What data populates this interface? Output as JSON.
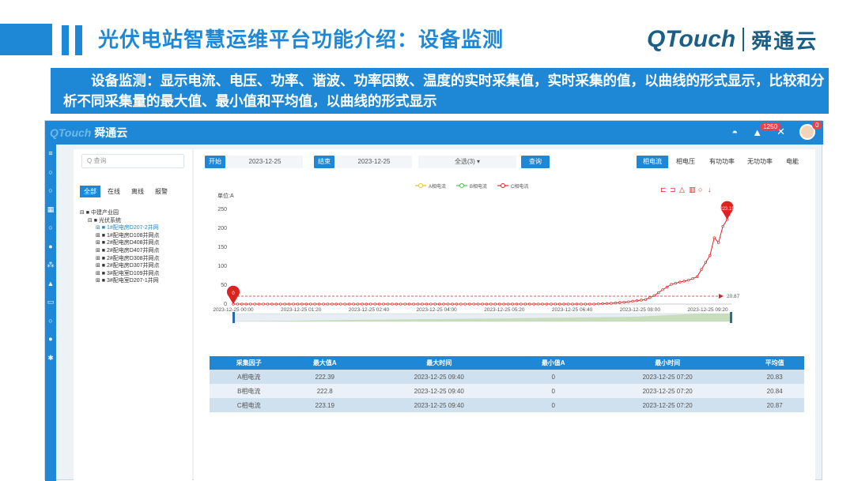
{
  "slide": {
    "title": "光伏电站智慧运维平台功能介绍：设备监测",
    "logo_brand": "QTouch",
    "logo_cn": "舜通云",
    "banner": "设备监测：显示电流、电压、功率、谐波、功率因数、温度的实时采集值，实时采集的值，以曲线的形式显示，比较和分析不同采集量的最大值、最小值和平均值，以曲线的形式显示"
  },
  "app": {
    "logo_brand": "QTouch",
    "logo_cn": "舜通云",
    "bell_badge": "1250",
    "avatar_badge": "0",
    "search_placeholder": "查询",
    "tabs": [
      "全部",
      "在线",
      "离线",
      "报警"
    ],
    "tree": {
      "root": "中建产业园",
      "system": "光伏系统",
      "items": [
        "1#配电房D207-2并网",
        "1#配电房D108并网点",
        "2#配电房D408并网点",
        "2#配电房D407并网点",
        "2#配电房D308并网点",
        "2#配电房D307并网点",
        "3#配电室D109并网点",
        "3#配电室D207-1并网"
      ]
    },
    "toolbar": {
      "start_label": "开始",
      "start_date": "2023-12-25",
      "end_label": "结束",
      "end_date": "2023-12-25",
      "select_all": "全选(3) ▾",
      "query": "查询",
      "phases": [
        "相电流",
        "相电压",
        "有功功率",
        "无功功率",
        "电能"
      ]
    }
  },
  "chart_data": {
    "type": "line",
    "ylabel": "单位:A",
    "ylim": [
      0,
      250
    ],
    "yticks": [
      0,
      50,
      100,
      150,
      200,
      250
    ],
    "xticks": [
      "2023-12-25 00:00",
      "2023-12-25 01:20",
      "2023-12-25 02:40",
      "2023-12-25 04:00",
      "2023-12-25 05:20",
      "2023-12-25 06:40",
      "2023-12-25 08:00",
      "2023-12-25 09:20"
    ],
    "legend": [
      "A相电流",
      "B相电流",
      "C相电流"
    ],
    "series": [
      {
        "name": "C相电流",
        "color": "#dd2222",
        "x_minutes": [
          0,
          60,
          120,
          180,
          240,
          300,
          360,
          420,
          440,
          460,
          480,
          490,
          500,
          510,
          520,
          530,
          540,
          550,
          555,
          560,
          565,
          570,
          575
        ],
        "values": [
          0,
          0,
          0,
          0,
          0,
          0,
          0,
          0,
          2,
          6,
          12,
          22,
          38,
          52,
          58,
          63,
          72,
          110,
          128,
          175,
          162,
          205,
          223.19
        ]
      }
    ],
    "max_marker": "223.19",
    "min_marker": "0",
    "avg_marker": "20.87",
    "toolbox_icons": [
      "area-zoom-icon",
      "zoom-reset-icon",
      "line-icon",
      "bar-icon",
      "restore-icon",
      "download-icon"
    ]
  },
  "table": {
    "headers": [
      "采集因子",
      "最大值A",
      "最大时间",
      "最小值A",
      "最小时间",
      "平均值"
    ],
    "rows": [
      [
        "A相电流",
        "222.39",
        "2023-12-25 09:40",
        "0",
        "2023-12-25 07:20",
        "20.83"
      ],
      [
        "B相电流",
        "222.8",
        "2023-12-25 09:40",
        "0",
        "2023-12-25 07:20",
        "20.84"
      ],
      [
        "C相电流",
        "223.19",
        "2023-12-25 09:40",
        "0",
        "2023-12-25 07:20",
        "20.87"
      ]
    ]
  }
}
